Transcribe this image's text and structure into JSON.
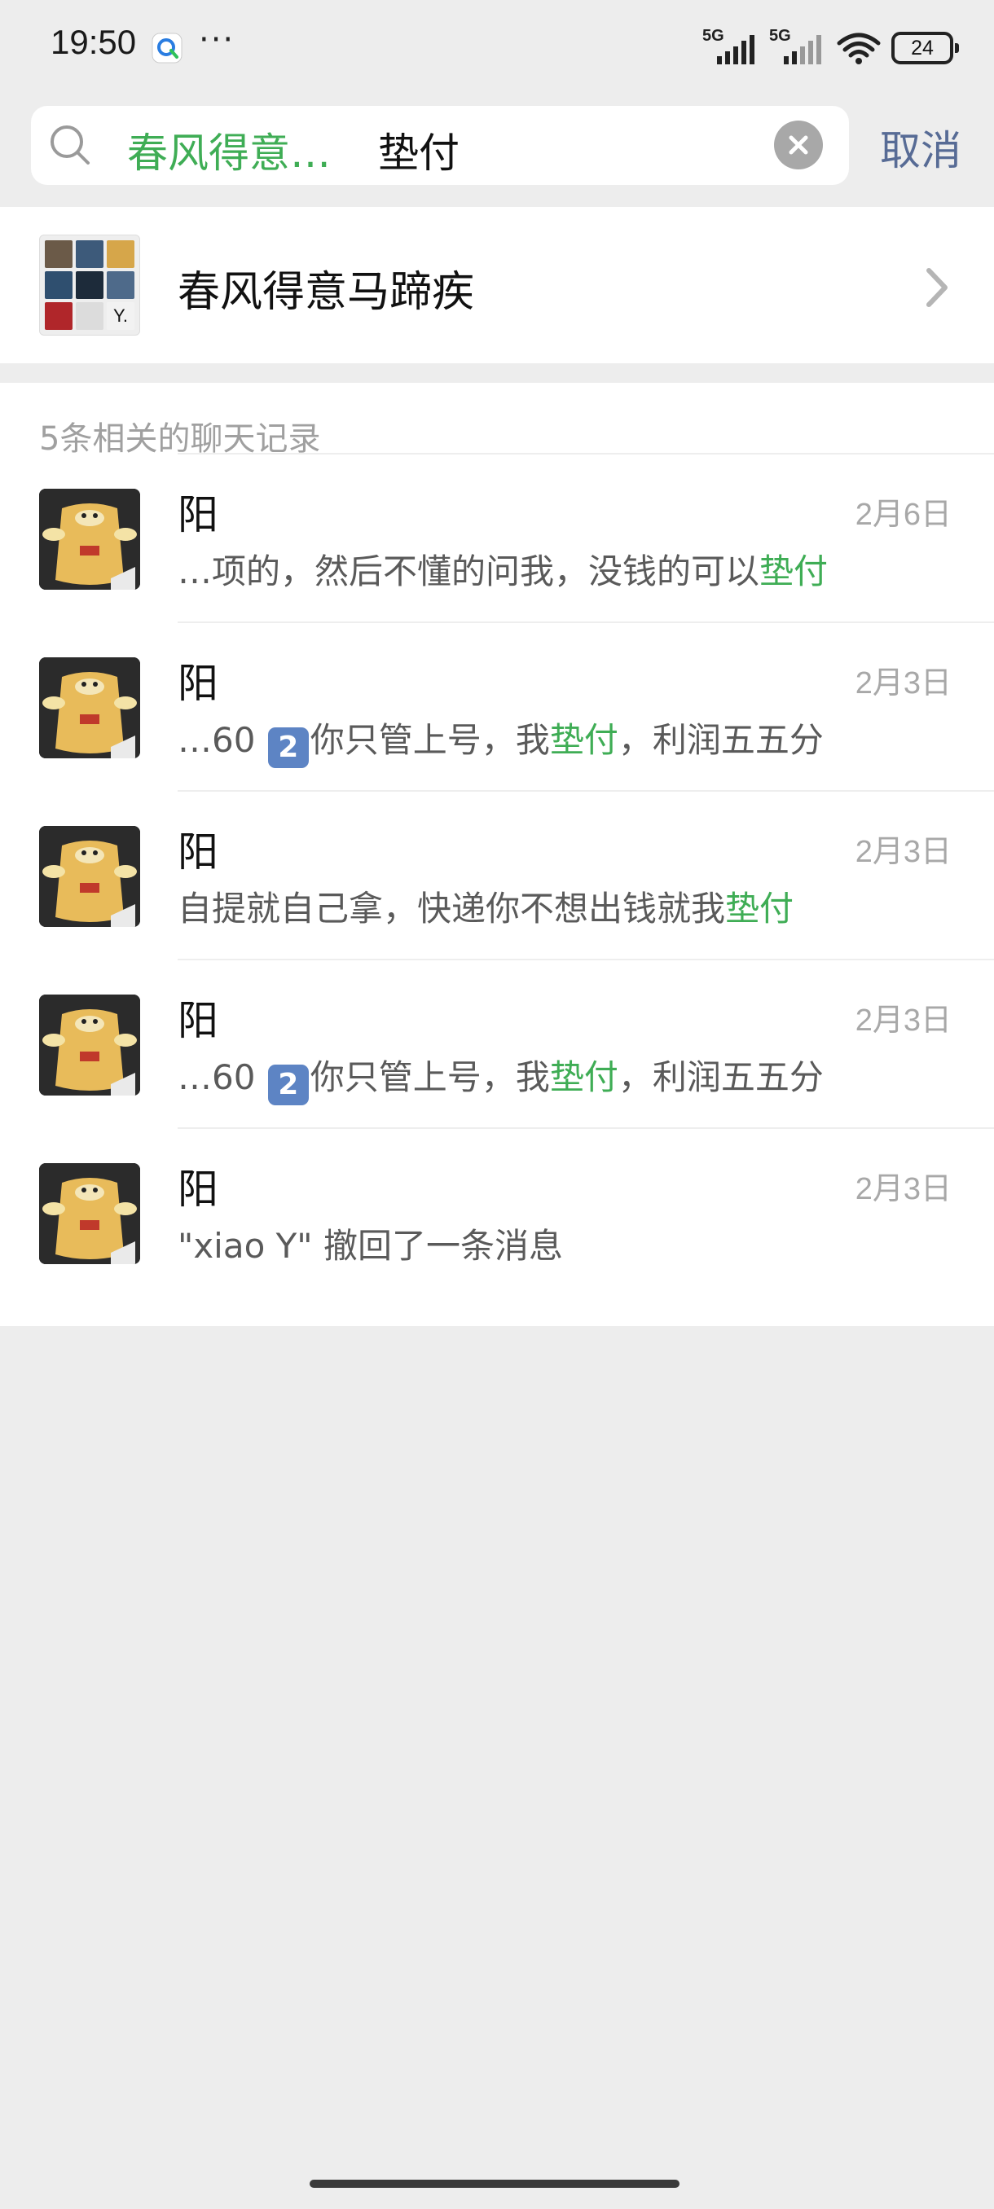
{
  "status_bar": {
    "time": "19:50",
    "dots": "···",
    "signal_1_label": "5G",
    "signal_2_label": "5G",
    "battery": "24"
  },
  "search": {
    "scope": "春风得意…",
    "term": "垫付",
    "cancel_label": "取消",
    "icons": {
      "search": "search-icon",
      "clear": "clear-icon"
    }
  },
  "group": {
    "name": "春风得意马蹄疾",
    "icon": "chevron-right-icon"
  },
  "records": {
    "title": "5条相关的聊天记录",
    "items": [
      {
        "name": "阳",
        "date": "2月6日",
        "pre": "…项的，然后不懂的问我，没钱的可以",
        "badge": "",
        "mid": "",
        "hl": "垫付",
        "post": ""
      },
      {
        "name": "阳",
        "date": "2月3日",
        "pre": "…60 ",
        "badge": "2",
        "mid": "你只管上号，我",
        "hl": "垫付",
        "post": "，利润五五分"
      },
      {
        "name": "阳",
        "date": "2月3日",
        "pre": "自提就自己拿，快递你不想出钱就我",
        "badge": "",
        "mid": "",
        "hl": "垫付",
        "post": ""
      },
      {
        "name": "阳",
        "date": "2月3日",
        "pre": "…60 ",
        "badge": "2",
        "mid": "你只管上号，我",
        "hl": "垫付",
        "post": "，利润五五分"
      },
      {
        "name": "阳",
        "date": "2月3日",
        "pre": "\"xiao Y\" 撤回了一条消息",
        "badge": "",
        "mid": "",
        "hl": "",
        "post": ""
      }
    ]
  },
  "colors": {
    "accent_green": "#3fad55",
    "link_blue": "#576b95",
    "background": "#ededed"
  }
}
